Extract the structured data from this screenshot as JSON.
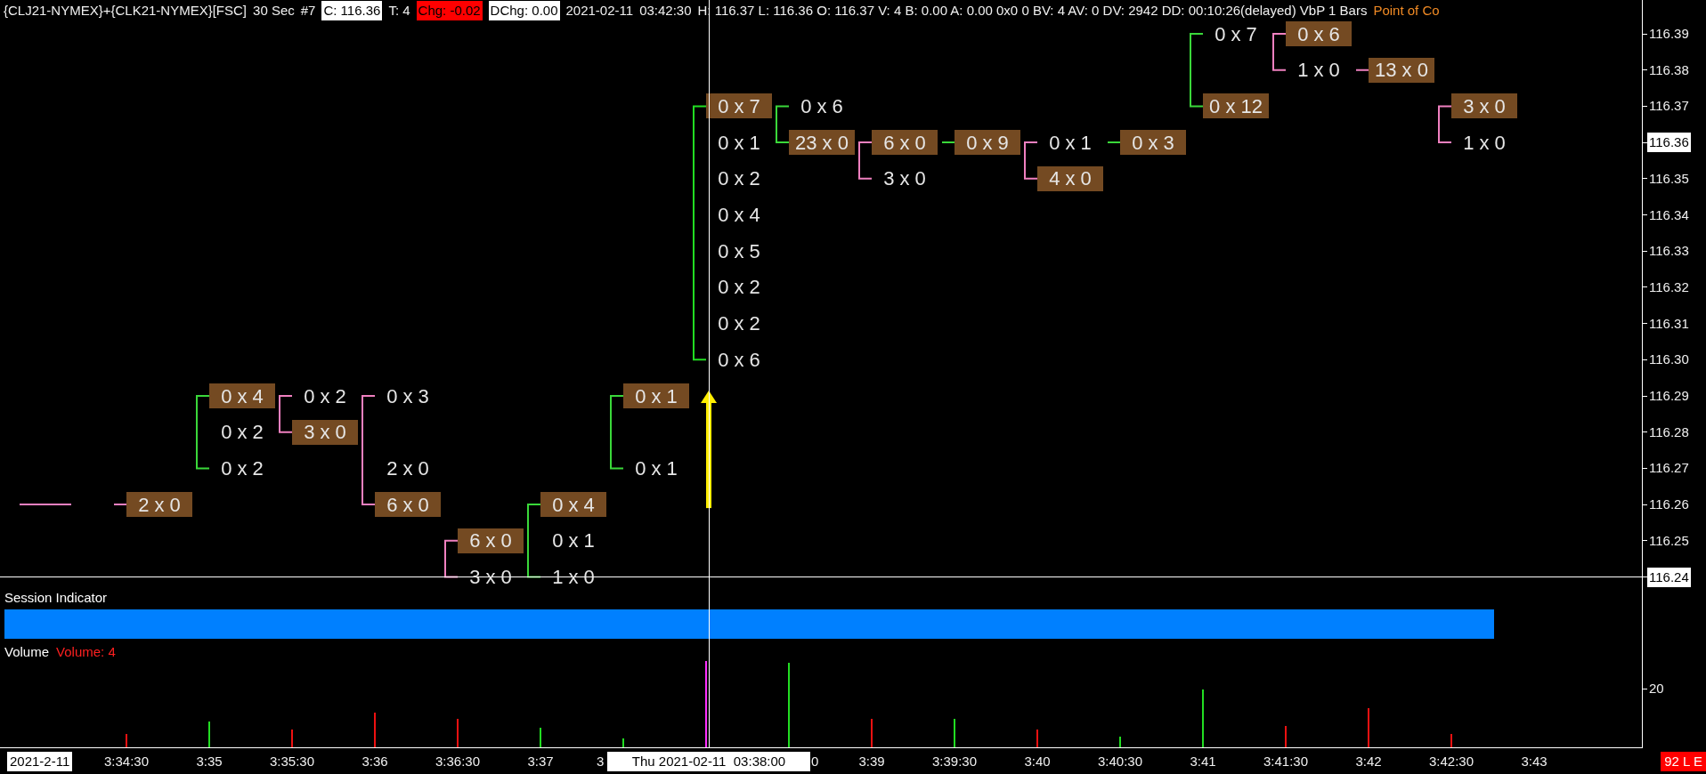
{
  "header": [
    {
      "text": "{CLJ21-NYMEX}+{CLK21-NYMEX}[FSC]",
      "kind": "plain"
    },
    {
      "text": "30 Sec",
      "kind": "plain"
    },
    {
      "text": "#7",
      "kind": "plain"
    },
    {
      "text": "C: 116.36",
      "kind": "boxed"
    },
    {
      "text": "T: 4",
      "kind": "plain"
    },
    {
      "text": "Chg: -0.02",
      "kind": "alert"
    },
    {
      "text": "DChg: 0.00",
      "kind": "boxed"
    },
    {
      "text": "2021-02-11",
      "kind": "plain"
    },
    {
      "text": "03:42:30",
      "kind": "plain"
    },
    {
      "text": "H: 116.37 L: 116.36 O: 116.37 V: 4 B: 0.00 A: 0.00 0x0 0 BV: 4 AV: 0 DV: 2942 DD: 00:10:26(delayed) VbP 1 Bars",
      "kind": "plain"
    },
    {
      "text": "Point of Co",
      "kind": "accent"
    }
  ],
  "bars": [
    {
      "color": "#ee1111",
      "selected": false
    },
    {
      "color": "#22dd22",
      "selected": false
    },
    {
      "color": "#ee1111",
      "selected": false
    },
    {
      "color": "#ee1111",
      "selected": false
    },
    {
      "color": "#ee1111",
      "selected": false
    },
    {
      "color": "#22dd22",
      "selected": false
    },
    {
      "color": "#22dd22",
      "selected": false
    },
    {
      "color": "#22dd22",
      "selected": true
    },
    {
      "color": "#22dd22",
      "selected": false
    },
    {
      "color": "#ee1111",
      "selected": false
    },
    {
      "color": "#22dd22",
      "selected": false
    },
    {
      "color": "#ee1111",
      "selected": false
    },
    {
      "color": "#22dd22",
      "selected": false
    },
    {
      "color": "#22dd22",
      "selected": false
    },
    {
      "color": "#ee1111",
      "selected": false
    },
    {
      "color": "#ee1111",
      "selected": false
    },
    {
      "color": "#ee1111",
      "selected": false
    }
  ],
  "rows": [
    {
      "price": "116.39",
      "highlighted": false,
      "cells": [
        null,
        null,
        null,
        null,
        null,
        null,
        null,
        null,
        null,
        null,
        null,
        null,
        null,
        {
          "text": "0 x 7",
          "poc": false
        },
        {
          "text": "0 x 6",
          "poc": true
        },
        null,
        null
      ]
    },
    {
      "price": "116.38",
      "highlighted": false,
      "cells": [
        null,
        null,
        null,
        null,
        null,
        null,
        null,
        null,
        null,
        null,
        null,
        null,
        null,
        null,
        {
          "text": "1 x 0",
          "poc": false
        },
        {
          "text": "13 x 0",
          "poc": true
        },
        null
      ]
    },
    {
      "price": "116.37",
      "highlighted": false,
      "cells": [
        null,
        null,
        null,
        null,
        null,
        null,
        null,
        {
          "text": "0 x 7",
          "poc": true
        },
        {
          "text": "0 x 6",
          "poc": false
        },
        null,
        null,
        null,
        null,
        {
          "text": "0 x 12",
          "poc": true
        },
        null,
        null,
        {
          "text": "3 x 0",
          "poc": true
        }
      ]
    },
    {
      "price": "116.36",
      "highlighted": true,
      "cells": [
        null,
        null,
        null,
        null,
        null,
        null,
        null,
        {
          "text": "0 x 1",
          "poc": false
        },
        {
          "text": "23 x 0",
          "poc": true
        },
        {
          "text": "6 x 0",
          "poc": true
        },
        {
          "text": "0 x 9",
          "poc": true
        },
        {
          "text": "0 x 1",
          "poc": false
        },
        {
          "text": "0 x 3",
          "poc": true
        },
        null,
        null,
        null,
        {
          "text": "1 x 0",
          "poc": false
        }
      ]
    },
    {
      "price": "116.35",
      "highlighted": false,
      "cells": [
        null,
        null,
        null,
        null,
        null,
        null,
        null,
        {
          "text": "0 x 2",
          "poc": false
        },
        null,
        {
          "text": "3 x 0",
          "poc": false
        },
        null,
        {
          "text": "4 x 0",
          "poc": true
        },
        null,
        null,
        null,
        null,
        null
      ]
    },
    {
      "price": "116.34",
      "highlighted": false,
      "cells": [
        null,
        null,
        null,
        null,
        null,
        null,
        null,
        {
          "text": "0 x 4",
          "poc": false
        },
        null,
        null,
        null,
        null,
        null,
        null,
        null,
        null,
        null
      ]
    },
    {
      "price": "116.33",
      "highlighted": false,
      "cells": [
        null,
        null,
        null,
        null,
        null,
        null,
        null,
        {
          "text": "0 x 5",
          "poc": false
        },
        null,
        null,
        null,
        null,
        null,
        null,
        null,
        null,
        null
      ]
    },
    {
      "price": "116.32",
      "highlighted": false,
      "cells": [
        null,
        null,
        null,
        null,
        null,
        null,
        null,
        {
          "text": "0 x 2",
          "poc": false
        },
        null,
        null,
        null,
        null,
        null,
        null,
        null,
        null,
        null
      ]
    },
    {
      "price": "116.31",
      "highlighted": false,
      "cells": [
        null,
        null,
        null,
        null,
        null,
        null,
        null,
        {
          "text": "0 x 2",
          "poc": false
        },
        null,
        null,
        null,
        null,
        null,
        null,
        null,
        null,
        null
      ]
    },
    {
      "price": "116.30",
      "highlighted": false,
      "cells": [
        null,
        null,
        null,
        null,
        null,
        null,
        null,
        {
          "text": "0 x 6",
          "poc": false
        },
        null,
        null,
        null,
        null,
        null,
        null,
        null,
        null,
        null
      ]
    },
    {
      "price": "116.29",
      "highlighted": false,
      "cells": [
        null,
        {
          "text": "0 x 4",
          "poc": true
        },
        {
          "text": "0 x 2",
          "poc": false
        },
        {
          "text": "0 x 3",
          "poc": false
        },
        null,
        null,
        {
          "text": "0 x 1",
          "poc": true
        },
        null,
        null,
        null,
        null,
        null,
        null,
        null,
        null,
        null,
        null
      ]
    },
    {
      "price": "116.28",
      "highlighted": false,
      "cells": [
        null,
        {
          "text": "0 x 2",
          "poc": false
        },
        {
          "text": "3 x 0",
          "poc": true
        },
        null,
        null,
        null,
        null,
        null,
        null,
        null,
        null,
        null,
        null,
        null,
        null,
        null,
        null
      ]
    },
    {
      "price": "116.27",
      "highlighted": false,
      "cells": [
        null,
        {
          "text": "0 x 2",
          "poc": false
        },
        null,
        {
          "text": "2 x 0",
          "poc": false
        },
        null,
        null,
        {
          "text": "0 x 1",
          "poc": false
        },
        null,
        null,
        null,
        null,
        null,
        null,
        null,
        null,
        null,
        null
      ]
    },
    {
      "price": "116.26",
      "highlighted": false,
      "cells": [
        {
          "text": "2 x 0",
          "poc": true
        },
        null,
        null,
        {
          "text": "6 x 0",
          "poc": true
        },
        null,
        {
          "text": "0 x 4",
          "poc": true
        },
        null,
        null,
        null,
        null,
        null,
        null,
        null,
        null,
        null,
        null,
        null
      ]
    },
    {
      "price": "116.25",
      "highlighted": false,
      "cells": [
        null,
        null,
        null,
        null,
        {
          "text": "6 x 0",
          "poc": true
        },
        {
          "text": "0 x 1",
          "poc": false
        },
        null,
        null,
        null,
        null,
        null,
        null,
        null,
        null,
        null,
        null,
        null
      ]
    },
    {
      "price": "116.24",
      "highlighted": true,
      "cells": [
        null,
        null,
        null,
        null,
        {
          "text": "3 x 0",
          "poc": false
        },
        {
          "text": "1 x 0",
          "poc": false
        },
        null,
        null,
        null,
        null,
        null,
        null,
        null,
        null,
        null,
        null,
        null
      ]
    }
  ],
  "session_panel": {
    "title": "Session Indicator"
  },
  "volume_panel": {
    "title": "Volume",
    "reading": "Volume: 4",
    "axis_label": "20"
  },
  "time_axis": {
    "date": "2021-2-11",
    "crosshair": "Thu 2021-02-11  03:38:00",
    "labels": [
      {
        "label": "3:34:30",
        "kind": "tick"
      },
      {
        "label": "3:35",
        "kind": "tick"
      },
      {
        "label": "3:35:30",
        "kind": "tick"
      },
      {
        "label": "3:36",
        "kind": "tick"
      },
      {
        "label": "3:36:30",
        "kind": "tick"
      },
      {
        "label": "3:37",
        "kind": "tick"
      },
      {
        "label": "3",
        "kind": "cut_before"
      },
      {
        "label": "0",
        "kind": "cut_after"
      },
      {
        "label": "3:39",
        "kind": "tick"
      },
      {
        "label": "3:39:30",
        "kind": "tick"
      },
      {
        "label": "3:40",
        "kind": "tick"
      },
      {
        "label": "3:40:30",
        "kind": "tick"
      },
      {
        "label": "3:41",
        "kind": "tick"
      },
      {
        "label": "3:41:30",
        "kind": "tick"
      },
      {
        "label": "3:42",
        "kind": "tick"
      },
      {
        "label": "3:42:30",
        "kind": "tick"
      },
      {
        "label": "3:43",
        "kind": "tick"
      }
    ],
    "status": "92 L E"
  }
}
